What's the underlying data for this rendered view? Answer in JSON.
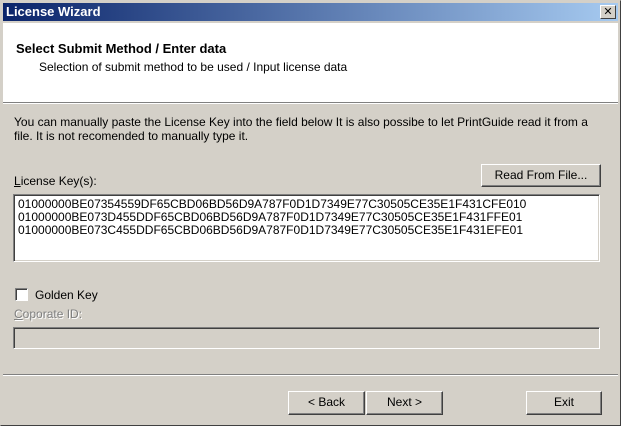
{
  "window": {
    "title": "License Wizard",
    "close_glyph": "✕"
  },
  "header": {
    "title": "Select Submit Method / Enter data",
    "subtitle": "Selection of submit method to be used / Input license data"
  },
  "description": "You can manually paste the License Key into the field below It is also possibe to let PrintGuide read it from a file. It is not recomended to manually type it.",
  "license_keys": {
    "label_accel": "L",
    "label_rest": "icense Key(s):",
    "lines": [
      "01000000BE07354559DF65CBD06BD56D9A787F0D1D7349E77C30505CE35E1F431CFE010",
      "01000000BE073D455DDF65CBD06BD56D9A787F0D1D7349E77C30505CE35E1F431FFE01",
      "01000000BE073C455DDF65CBD06BD56D9A787F0D1D7349E77C30505CE35E1F431EFE01"
    ],
    "read_from_file_label": "Read From File..."
  },
  "golden_key": {
    "label": "Golden Key",
    "checked": false
  },
  "corporate_id": {
    "label_accel": "C",
    "label_rest": "oporate ID:",
    "value": ""
  },
  "footer": {
    "back_label": "< Back",
    "next_label": "Next >",
    "exit_label": "Exit"
  },
  "colors": {
    "face": "#d4d0c8",
    "title_active": "#0a246a",
    "title_gradient_end": "#a6caf0"
  }
}
